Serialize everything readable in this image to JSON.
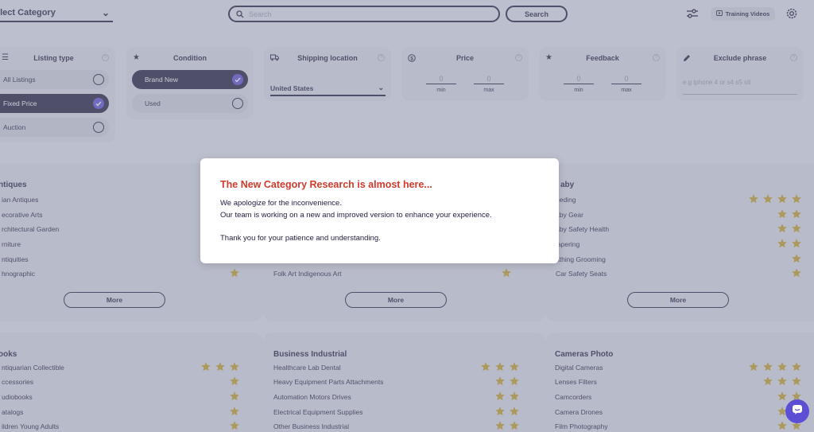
{
  "topbar": {
    "category_select": "elect Category",
    "search_placeholder": "Search",
    "search_button": "Search",
    "training_videos": "Training Videos"
  },
  "filters": {
    "listing_type": {
      "title": "Listing type",
      "options": [
        {
          "label": "All Listings",
          "selected": false
        },
        {
          "label": "Fixed Price",
          "selected": true
        },
        {
          "label": "Auction",
          "selected": false
        }
      ]
    },
    "condition": {
      "title": "Condition",
      "options": [
        {
          "label": "Brand New",
          "selected": true
        },
        {
          "label": "Used",
          "selected": false
        }
      ]
    },
    "shipping_location": {
      "title": "Shipping location",
      "value": "United States"
    },
    "price": {
      "title": "Price",
      "min_value": "0",
      "max_value": "0",
      "min_label": "min",
      "max_label": "max"
    },
    "feedback": {
      "title": "Feedback",
      "min_value": "0",
      "max_value": "0",
      "min_label": "min",
      "max_label": "max"
    },
    "exclude_phrase": {
      "title": "Exclude phrase",
      "placeholder": "e.g iphone 4 or s4 s5 s6"
    }
  },
  "categories": [
    {
      "title": "ntiques",
      "items": [
        {
          "label": "ian Antiques",
          "stars": 0
        },
        {
          "label": "ecorative Arts",
          "stars": 0
        },
        {
          "label": "rchitectural Garden",
          "stars": 0
        },
        {
          "label": "rniture",
          "stars": 0
        },
        {
          "label": "ntiquities",
          "stars": 0
        },
        {
          "label": "hnographic",
          "stars": 1
        }
      ],
      "more": "More"
    },
    {
      "title": "",
      "items": [
        {
          "label": "Folk Art Indigenous Art",
          "stars": 1
        }
      ],
      "more": "More"
    },
    {
      "title": "aby",
      "items": [
        {
          "label": "eeding",
          "stars": 4
        },
        {
          "label": "aby Gear",
          "stars": 2
        },
        {
          "label": "aby Safety Health",
          "stars": 2
        },
        {
          "label": "iapering",
          "stars": 2
        },
        {
          "label": "athing Grooming",
          "stars": 1
        },
        {
          "label": "Car Safety Seats",
          "stars": 1
        }
      ],
      "more": "More"
    },
    {
      "title": "ooks",
      "items": [
        {
          "label": "ntiquarian Collectible",
          "stars": 3
        },
        {
          "label": "ccessories",
          "stars": 1
        },
        {
          "label": "udiobooks",
          "stars": 1
        },
        {
          "label": "atalogs",
          "stars": 1
        },
        {
          "label": "ildren Young Adults",
          "stars": 1
        }
      ]
    },
    {
      "title": "Business Industrial",
      "items": [
        {
          "label": "Healthcare Lab Dental",
          "stars": 3
        },
        {
          "label": "Heavy Equipment Parts Attachments",
          "stars": 2
        },
        {
          "label": "Automation Motors Drives",
          "stars": 2
        },
        {
          "label": "Electrical Equipment Supplies",
          "stars": 2
        },
        {
          "label": "Other Business Industrial",
          "stars": 2
        }
      ]
    },
    {
      "title": "Cameras Photo",
      "items": [
        {
          "label": "Digital Cameras",
          "stars": 4
        },
        {
          "label": "Lenses Filters",
          "stars": 3
        },
        {
          "label": "Camcorders",
          "stars": 2
        },
        {
          "label": "Camera Drones",
          "stars": 2
        },
        {
          "label": "Film Photography",
          "stars": 2
        }
      ]
    }
  ],
  "modal": {
    "title": "The New Category Research is almost here...",
    "line1": "We apologize for the inconvenience.",
    "line2": "Our team is working on a new and improved version to enhance your experience.",
    "line3": "Thank you for your patience and understanding."
  },
  "colors": {
    "navy": "#1f1d3d",
    "accent": "#5c4fd6",
    "star": "#c9a227",
    "modal_title": "#d13b2d",
    "overlay": "#8a8ea2"
  }
}
